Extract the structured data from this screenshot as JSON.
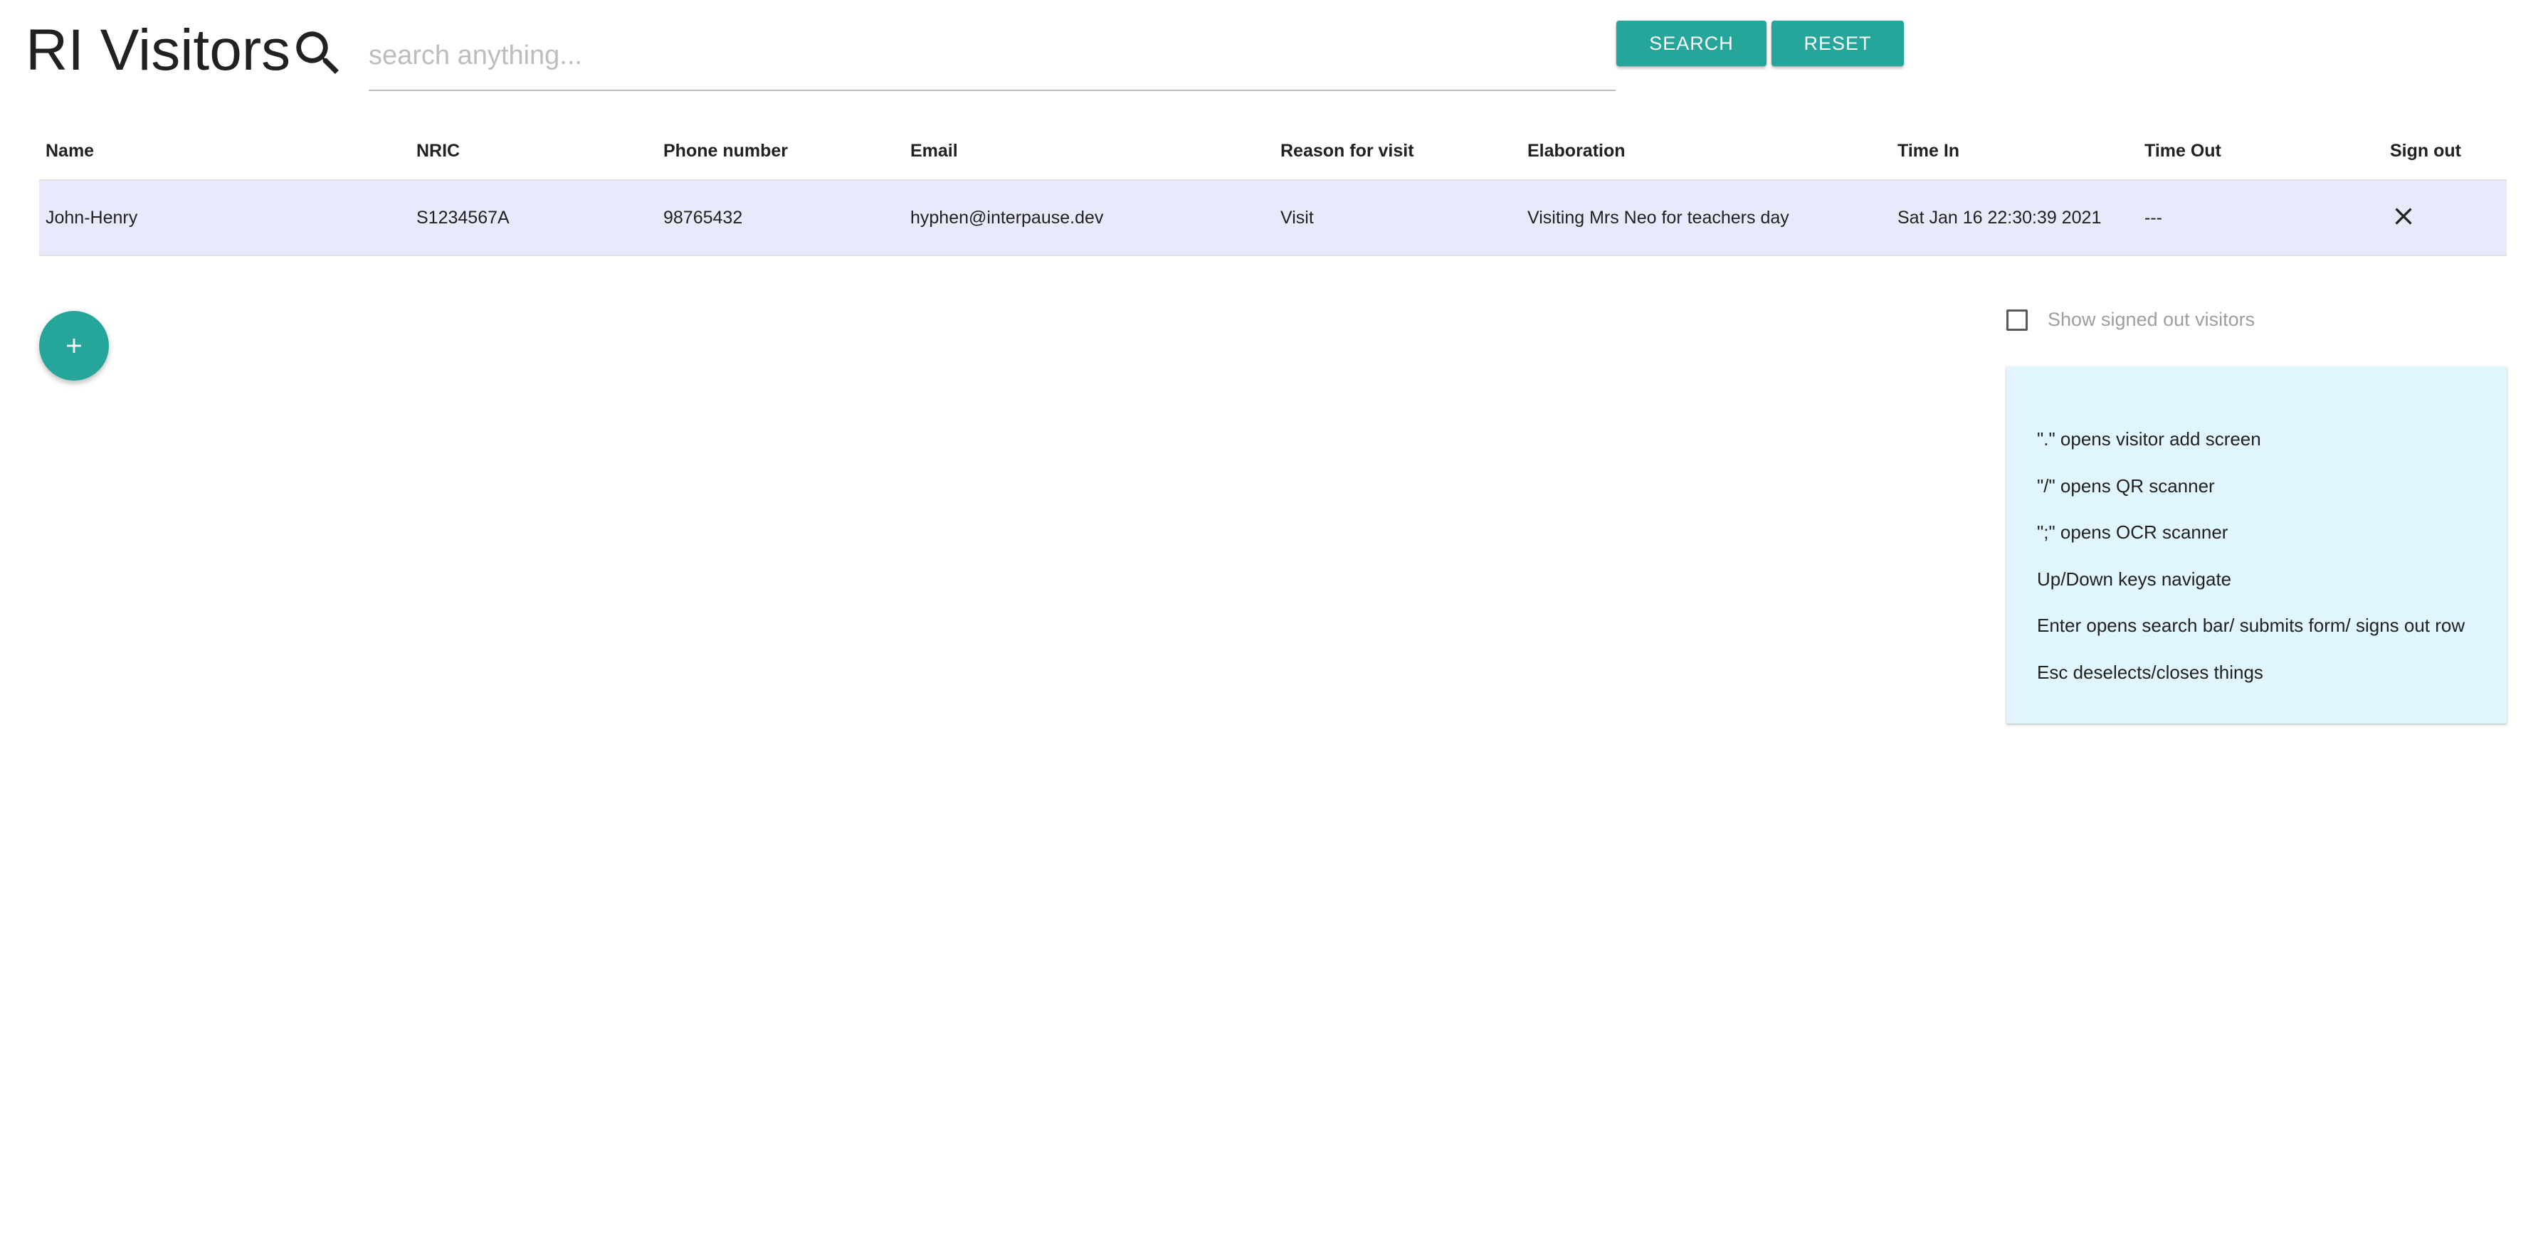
{
  "header": {
    "title": "RI Visitors",
    "search_icon": "search-icon",
    "search_placeholder": "search anything...",
    "search_value": "",
    "search_button": "SEARCH",
    "reset_button": "RESET"
  },
  "table": {
    "columns": [
      "Name",
      "NRIC",
      "Phone number",
      "Email",
      "Reason for visit",
      "Elaboration",
      "Time In",
      "Time Out",
      "Sign out"
    ],
    "rows": [
      {
        "name": "John-Henry",
        "nric": "S1234567A",
        "phone": "98765432",
        "email": "hyphen@interpause.dev",
        "reason": "Visit",
        "elaboration": "Visiting Mrs Neo for teachers day",
        "time_in": "Sat Jan 16 22:30:39 2021",
        "time_out": "---",
        "sign_out_icon": "close-icon"
      }
    ],
    "selected_row_color": "#e8eafc"
  },
  "fab": {
    "icon": "plus-icon"
  },
  "options": {
    "show_signed_out_label": "Show signed out visitors",
    "show_signed_out_checked": false
  },
  "help": {
    "items": [
      "\".\" opens visitor add screen",
      "\"/\" opens QR scanner",
      "\";\" opens OCR scanner",
      "Up/Down keys navigate",
      "Enter opens search bar/ submits form/ signs out row",
      "Esc deselects/closes things"
    ]
  },
  "colors": {
    "accent": "#26a69a",
    "help_background": "#e1f5fe",
    "text": "#212121"
  }
}
